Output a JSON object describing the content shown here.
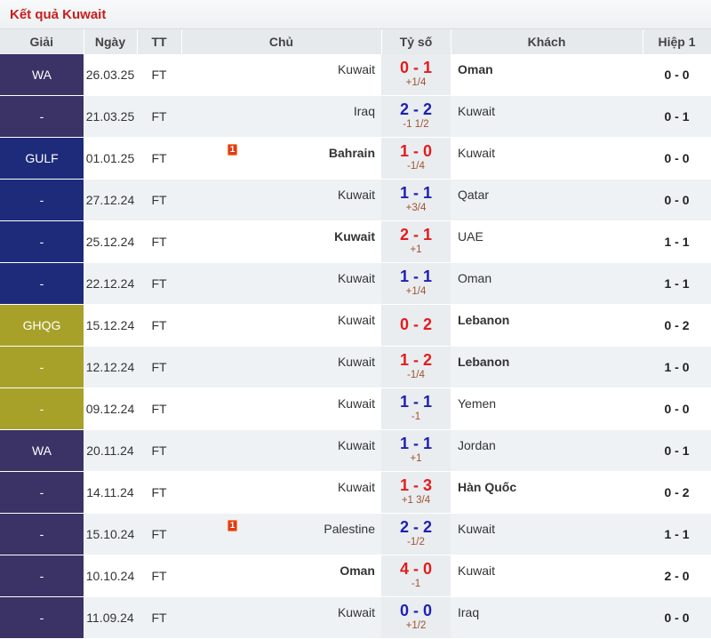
{
  "title": "Kết quả Kuwait",
  "headers": {
    "league": "Giải",
    "date": "Ngày",
    "status": "TT",
    "home": "Chủ",
    "score": "Tỷ số",
    "away": "Khách",
    "half": "Hiệp 1"
  },
  "league_colors": {
    "WA": "#3b3365",
    "GULF": "#1d2b7a",
    "GHQG": "#a7a12a"
  },
  "rows": [
    {
      "league": "WA",
      "league_color": "#3b3365",
      "date": "26.03.25",
      "status": "FT",
      "home": "Kuwait",
      "home_bold": false,
      "score": "0 - 1",
      "score_color": "red",
      "handicap": "+1/4",
      "away": "Oman",
      "away_bold": true,
      "half": "0 - 0",
      "red_card": ""
    },
    {
      "league": "-",
      "league_color": "#3b3365",
      "date": "21.03.25",
      "status": "FT",
      "home": "Iraq",
      "home_bold": false,
      "score": "2 - 2",
      "score_color": "blue",
      "handicap": "-1 1/2",
      "away": "Kuwait",
      "away_bold": false,
      "half": "0 - 1",
      "red_card": ""
    },
    {
      "league": "GULF",
      "league_color": "#1d2b7a",
      "date": "01.01.25",
      "status": "FT",
      "home": "Bahrain",
      "home_bold": true,
      "score": "1 - 0",
      "score_color": "red",
      "handicap": "-1/4",
      "away": "Kuwait",
      "away_bold": false,
      "half": "0 - 0",
      "red_card": "1"
    },
    {
      "league": "-",
      "league_color": "#1d2b7a",
      "date": "27.12.24",
      "status": "FT",
      "home": "Kuwait",
      "home_bold": false,
      "score": "1 - 1",
      "score_color": "blue",
      "handicap": "+3/4",
      "away": "Qatar",
      "away_bold": false,
      "half": "0 - 0",
      "red_card": ""
    },
    {
      "league": "-",
      "league_color": "#1d2b7a",
      "date": "25.12.24",
      "status": "FT",
      "home": "Kuwait",
      "home_bold": true,
      "score": "2 - 1",
      "score_color": "red",
      "handicap": "+1",
      "away": "UAE",
      "away_bold": false,
      "half": "1 - 1",
      "red_card": ""
    },
    {
      "league": "-",
      "league_color": "#1d2b7a",
      "date": "22.12.24",
      "status": "FT",
      "home": "Kuwait",
      "home_bold": false,
      "score": "1 - 1",
      "score_color": "blue",
      "handicap": "+1/4",
      "away": "Oman",
      "away_bold": false,
      "half": "1 - 1",
      "red_card": ""
    },
    {
      "league": "GHQG",
      "league_color": "#a7a12a",
      "date": "15.12.24",
      "status": "FT",
      "home": "Kuwait",
      "home_bold": false,
      "score": "0 - 2",
      "score_color": "red",
      "handicap": "",
      "away": "Lebanon",
      "away_bold": true,
      "half": "0 - 2",
      "red_card": ""
    },
    {
      "league": "-",
      "league_color": "#a7a12a",
      "date": "12.12.24",
      "status": "FT",
      "home": "Kuwait",
      "home_bold": false,
      "score": "1 - 2",
      "score_color": "red",
      "handicap": "-1/4",
      "away": "Lebanon",
      "away_bold": true,
      "half": "1 - 0",
      "red_card": ""
    },
    {
      "league": "-",
      "league_color": "#a7a12a",
      "date": "09.12.24",
      "status": "FT",
      "home": "Kuwait",
      "home_bold": false,
      "score": "1 - 1",
      "score_color": "blue",
      "handicap": "-1",
      "away": "Yemen",
      "away_bold": false,
      "half": "0 - 0",
      "red_card": ""
    },
    {
      "league": "WA",
      "league_color": "#3b3365",
      "date": "20.11.24",
      "status": "FT",
      "home": "Kuwait",
      "home_bold": false,
      "score": "1 - 1",
      "score_color": "blue",
      "handicap": "+1",
      "away": "Jordan",
      "away_bold": false,
      "half": "0 - 1",
      "red_card": ""
    },
    {
      "league": "-",
      "league_color": "#3b3365",
      "date": "14.11.24",
      "status": "FT",
      "home": "Kuwait",
      "home_bold": false,
      "score": "1 - 3",
      "score_color": "red",
      "handicap": "+1 3/4",
      "away": "Hàn Quốc",
      "away_bold": true,
      "half": "0 - 2",
      "red_card": ""
    },
    {
      "league": "-",
      "league_color": "#3b3365",
      "date": "15.10.24",
      "status": "FT",
      "home": "Palestine",
      "home_bold": false,
      "score": "2 - 2",
      "score_color": "blue",
      "handicap": "-1/2",
      "away": "Kuwait",
      "away_bold": false,
      "half": "1 - 1",
      "red_card": "1"
    },
    {
      "league": "-",
      "league_color": "#3b3365",
      "date": "10.10.24",
      "status": "FT",
      "home": "Oman",
      "home_bold": true,
      "score": "4 - 0",
      "score_color": "red",
      "handicap": "-1",
      "away": "Kuwait",
      "away_bold": false,
      "half": "2 - 0",
      "red_card": ""
    },
    {
      "league": "-",
      "league_color": "#3b3365",
      "date": "11.09.24",
      "status": "FT",
      "home": "Kuwait",
      "home_bold": false,
      "score": "0 - 0",
      "score_color": "blue",
      "handicap": "+1/2",
      "away": "Iraq",
      "away_bold": false,
      "half": "0 - 0",
      "red_card": ""
    }
  ]
}
